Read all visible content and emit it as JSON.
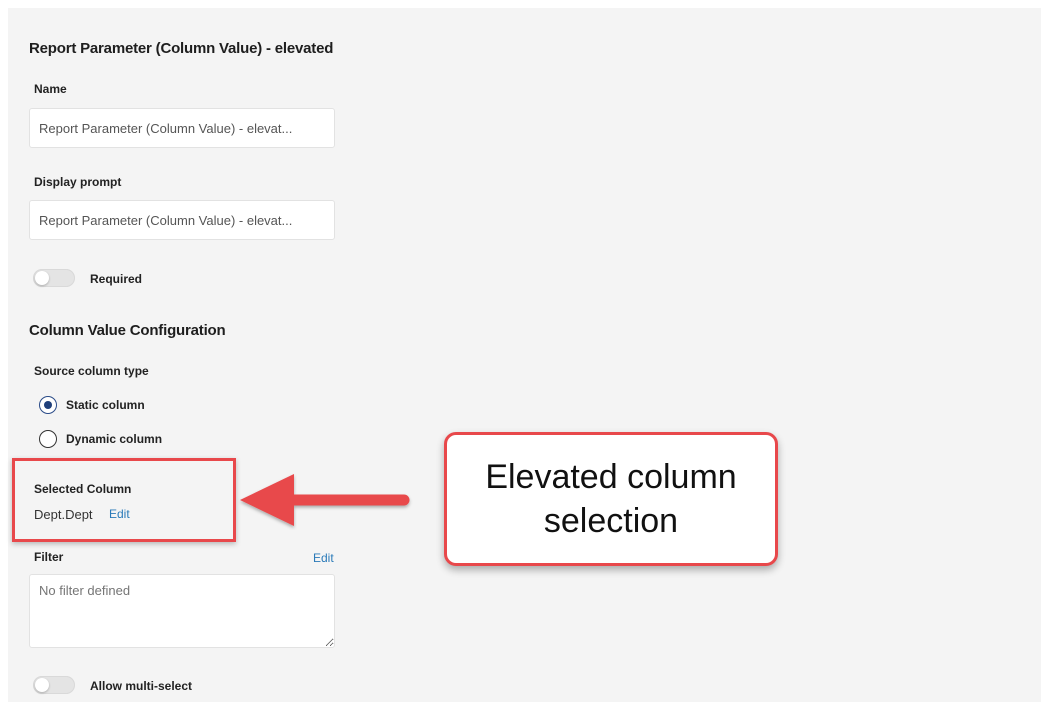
{
  "panel": {
    "title": "Report Parameter (Column Value) - elevated"
  },
  "name_field": {
    "label": "Name",
    "value": "Report Parameter (Column Value) - elevat..."
  },
  "display_prompt_field": {
    "label": "Display prompt",
    "value": "Report Parameter (Column Value) - elevat..."
  },
  "required_toggle": {
    "label": "Required",
    "on": false
  },
  "column_value_configuration": {
    "title": "Column Value Configuration",
    "source_column_type": {
      "label": "Source column type",
      "options": [
        {
          "label": "Static column",
          "selected": true
        },
        {
          "label": "Dynamic column",
          "selected": false
        }
      ]
    },
    "selected_column": {
      "label": "Selected Column",
      "value": "Dept.Dept",
      "edit_label": "Edit"
    },
    "filter": {
      "label": "Filter",
      "edit_label": "Edit",
      "placeholder": "No filter defined"
    }
  },
  "multi_select_toggle": {
    "label": "Allow multi-select",
    "on": false
  },
  "annotation": {
    "callout_text": "Elevated column selection",
    "color": "#e8484b"
  }
}
